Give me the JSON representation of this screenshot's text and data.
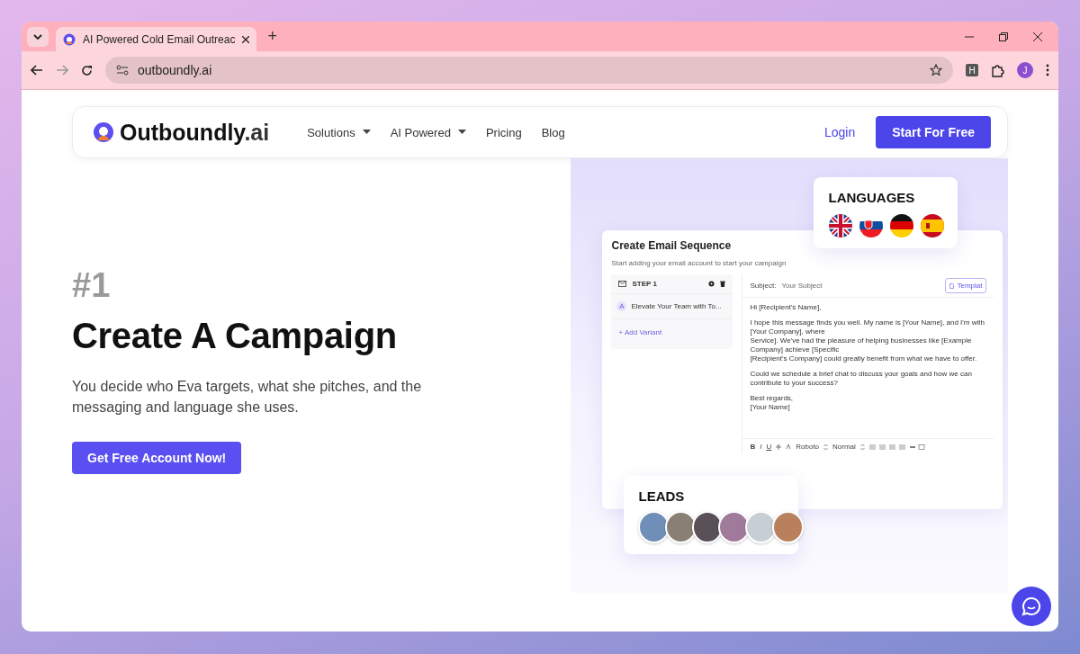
{
  "browser": {
    "tabs": [
      {
        "title": "AI Powered Cold Email Outreac",
        "selected": true
      }
    ],
    "new_tab": "+",
    "url": "outboundly.ai",
    "profile_initial": "J",
    "extension_label": "H"
  },
  "nav": {
    "logo_main": "Outboundly",
    "logo_suffix": ".ai",
    "links": [
      {
        "label": "Solutions",
        "dropdown": true
      },
      {
        "label": "AI Powered",
        "dropdown": true
      },
      {
        "label": "Pricing",
        "dropdown": false
      },
      {
        "label": "Blog",
        "dropdown": false
      }
    ],
    "login": "Login",
    "cta": "Start For Free"
  },
  "hero": {
    "eyebrow": "#1",
    "title": "Create A Campaign",
    "description": "You decide who Eva targets, what she pitches, and the messaging and language she uses.",
    "button": "Get Free Account Now!"
  },
  "sequence": {
    "title": "Create Email Sequence",
    "subtitle": "Start adding your email account to start your campaign",
    "step": "STEP 1",
    "variants": [
      {
        "badge": "A",
        "label": "Elevate Your Team with To..."
      }
    ],
    "add_variant": "+ Add Variant",
    "subject_label": "Subject:",
    "subject_placeholder": "Your Subject",
    "templates": "Templat",
    "body": [
      [
        "Hi [Recipient's Name],"
      ],
      [
        "I hope this message finds you well. My name is [Your Name], and I'm with [Your Company], where",
        "Service]. We've had the pleasure of helping businesses like [Example Company] achieve [Specific",
        "[Recipient's Company] could greatly benefit from what we have to offer."
      ],
      [
        "Could we schedule a brief chat to discuss your goals and how we can contribute to your success?"
      ],
      [
        "Best regards,",
        "[Your Name]"
      ]
    ],
    "toolbar": {
      "bold": "B",
      "italic": "I",
      "underline": "U",
      "font": "Roboto",
      "size": "Normal"
    }
  },
  "languages": {
    "title": "LANGUAGES",
    "flags": [
      {
        "kind": "uk"
      },
      {
        "kind": "slovakia"
      },
      {
        "kind": "germany"
      },
      {
        "kind": "spain"
      }
    ]
  },
  "leads": {
    "title": "LEADS",
    "avatars": [
      {
        "color": "#6f8fb8"
      },
      {
        "color": "#8a7f74"
      },
      {
        "color": "#5a5058"
      },
      {
        "color": "#a07a9a"
      },
      {
        "color": "#c8cfd4"
      },
      {
        "color": "#b9805e"
      }
    ]
  }
}
